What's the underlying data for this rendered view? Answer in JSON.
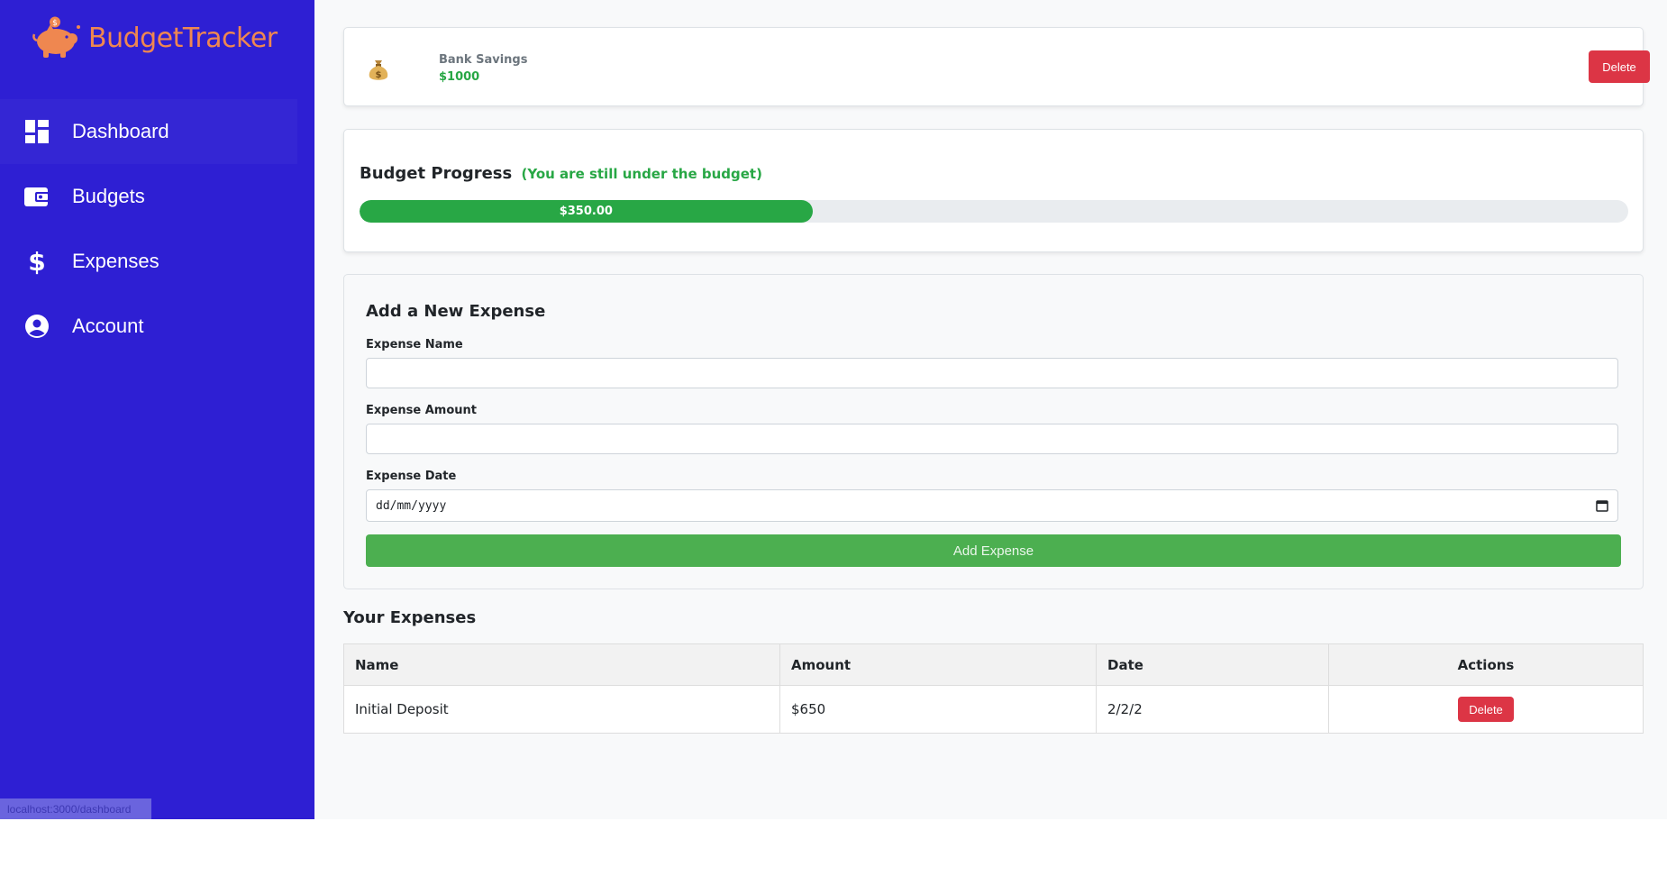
{
  "sidebar": {
    "brand": "BudgetTracker",
    "items": [
      {
        "label": "Dashboard",
        "icon": "dashboard-icon"
      },
      {
        "label": "Budgets",
        "icon": "wallet-icon"
      },
      {
        "label": "Expenses",
        "icon": "dollar-icon"
      },
      {
        "label": "Account",
        "icon": "account-circle-icon"
      }
    ],
    "status_url": "localhost:3000/dashboard"
  },
  "savings": {
    "icon": "money-bag-icon",
    "name": "Bank Savings",
    "amount": "$1000",
    "delete_label": "Delete"
  },
  "progress": {
    "title": "Budget Progress",
    "note": "(You are still under the budget)",
    "bar_label": "$350.00",
    "fraction": 0.357
  },
  "form": {
    "title": "Add a New Expense",
    "name_label": "Expense Name",
    "name_value": "",
    "amount_label": "Expense Amount",
    "amount_value": "",
    "date_label": "Expense Date",
    "date_placeholder": "dd/mm/yyyy",
    "submit_label": "Add Expense"
  },
  "expenses": {
    "heading": "Your Expenses",
    "columns": [
      "Name",
      "Amount",
      "Date",
      "Actions"
    ],
    "rows": [
      {
        "name": "Initial Deposit",
        "amount": "$650",
        "date": "2/2/2",
        "action": "Delete"
      }
    ]
  },
  "colors": {
    "sidebar": "#2e1fd3",
    "brand": "#ef8750",
    "success": "#28a745",
    "danger": "#dc3545",
    "add_button": "#4caf50"
  }
}
